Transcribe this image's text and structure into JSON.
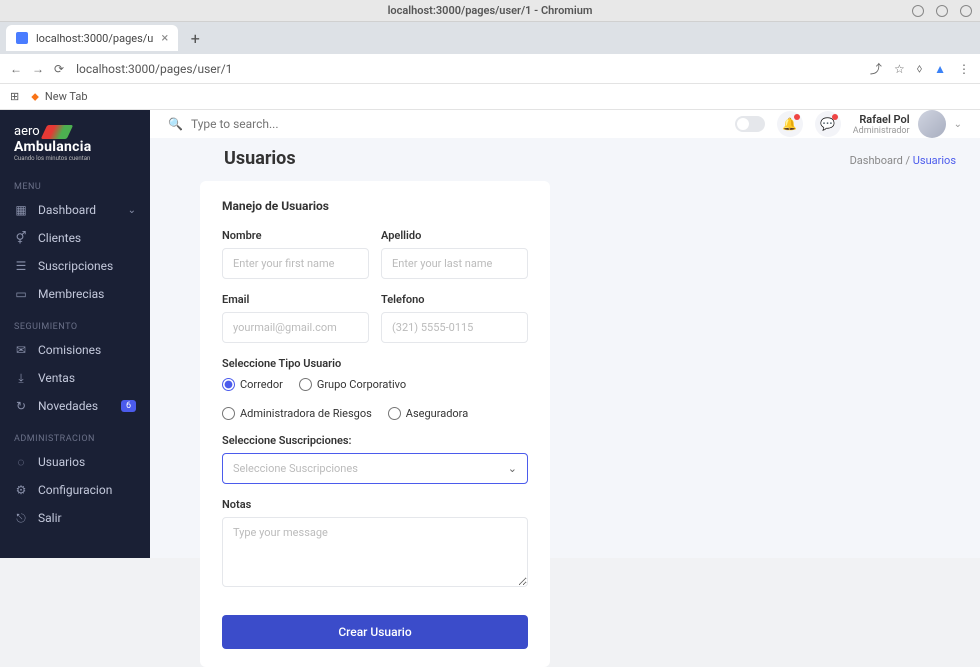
{
  "os": {
    "window_title": "localhost:3000/pages/user/1 - Chromium"
  },
  "browser": {
    "tab_title": "localhost:3000/pages/u",
    "url": "localhost:3000/pages/user/1",
    "bookmark_newtab": "New Tab"
  },
  "topbar": {
    "search_placeholder": "Type to search...",
    "user_name": "Rafael Pol",
    "user_role": "Administrador"
  },
  "logo": {
    "line1": "aero",
    "line2": "Ambulancia",
    "line3": "Cuando los minutos cuentan"
  },
  "sidebar": {
    "section_menu": "MENU",
    "section_seg": "SEGUIMIENTO",
    "section_admin": "ADMINISTRACION",
    "items": {
      "dashboard": "Dashboard",
      "clientes": "Clientes",
      "suscripciones": "Suscripciones",
      "membrecias": "Membrecias",
      "comisiones": "Comisiones",
      "ventas": "Ventas",
      "novedades": "Novedades",
      "novedades_badge": "6",
      "usuarios": "Usuarios",
      "configuracion": "Configuracion",
      "salir": "Salir"
    }
  },
  "breadcrumb": {
    "title": "Usuarios",
    "root": "Dashboard",
    "current": "Usuarios"
  },
  "form": {
    "card_title": "Manejo de Usuarios",
    "nombre_label": "Nombre",
    "nombre_ph": "Enter your first name",
    "apellido_label": "Apellido",
    "apellido_ph": "Enter your last name",
    "email_label": "Email",
    "email_ph": "yourmail@gmail.com",
    "telefono_label": "Telefono",
    "telefono_ph": "(321) 5555-0115",
    "tipo_label": "Seleccione Tipo Usuario",
    "radio1": "Corredor",
    "radio2": "Grupo Corporativo",
    "radio3": "Administradora de Riesgos",
    "radio4": "Aseguradora",
    "sub_label": "Seleccione Suscripciones:",
    "sub_ph": "Seleccione Suscripciones",
    "notas_label": "Notas",
    "notas_ph": "Type your message",
    "submit": "Crear Usuario"
  }
}
